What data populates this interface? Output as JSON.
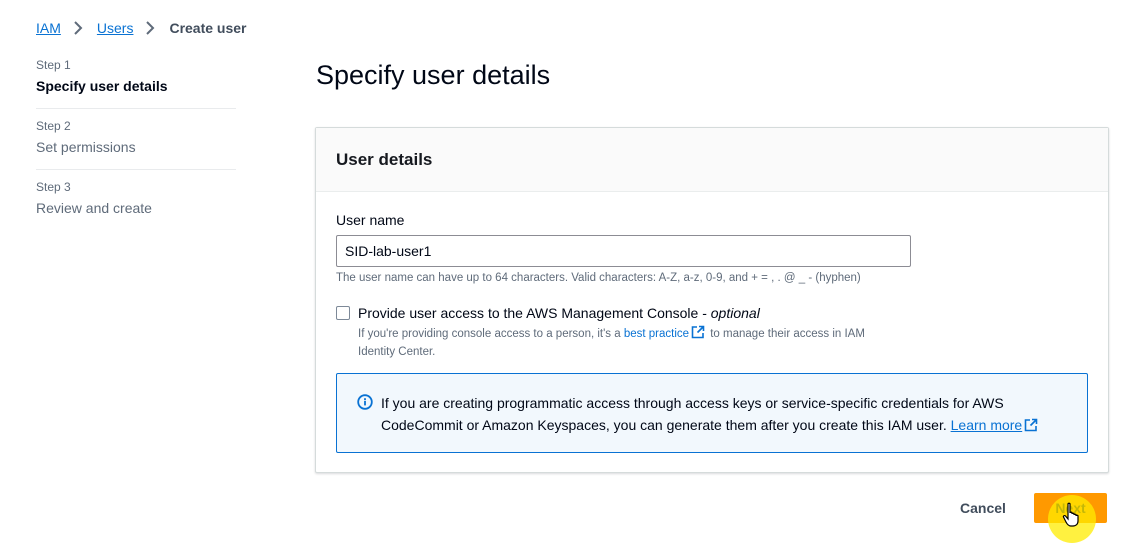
{
  "breadcrumb": {
    "items": [
      "IAM",
      "Users"
    ],
    "current": "Create user"
  },
  "steps": [
    {
      "number": "Step 1",
      "title": "Specify user details",
      "active": true
    },
    {
      "number": "Step 2",
      "title": "Set permissions",
      "active": false
    },
    {
      "number": "Step 3",
      "title": "Review and create",
      "active": false
    }
  ],
  "page": {
    "title": "Specify user details"
  },
  "user_details": {
    "header": "User details",
    "username_label": "User name",
    "username_value": "SID-lab-user1",
    "username_hint": "The user name can have up to 64 characters. Valid characters: A-Z, a-z, 0-9, and + = , . @ _ - (hyphen)",
    "console_access": {
      "label": "Provide user access to the AWS Management Console - ",
      "label_optional": "optional",
      "checked": false,
      "desc_before": "If you're providing console access to a person, it's a ",
      "desc_link": "best practice",
      "desc_after": " to manage their access in IAM Identity Center."
    },
    "info": {
      "text": "If you are creating programmatic access through access keys or service-specific credentials for AWS CodeCommit or Amazon Keyspaces, you can generate them after you create this IAM user. ",
      "link": "Learn more"
    }
  },
  "footer": {
    "cancel_label": "Cancel",
    "next_label": "Next"
  },
  "colors": {
    "link": "#0972d3",
    "primary_button": "#ff9900",
    "info_border": "#0972d3",
    "info_bg": "#f2f8fd"
  }
}
